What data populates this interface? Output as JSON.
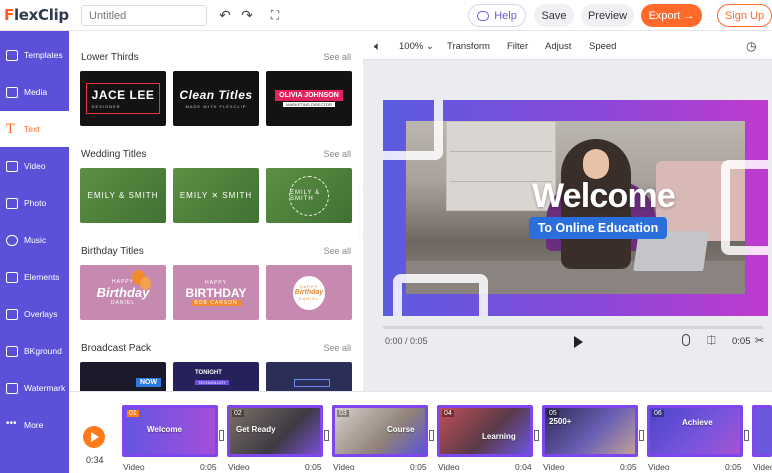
{
  "header": {
    "logo_prefix": "F",
    "logo_rest": "lexClip",
    "title_placeholder": "Untitled",
    "help_label": "Help",
    "save_label": "Save",
    "preview_label": "Preview",
    "export_label": "Export →",
    "signup_label": "Sign Up"
  },
  "sidebar": {
    "items": [
      {
        "label": "Templates"
      },
      {
        "label": "Media"
      },
      {
        "label": "Text",
        "active": true
      },
      {
        "label": "Video"
      },
      {
        "label": "Photo"
      },
      {
        "label": "Music"
      },
      {
        "label": "Elements"
      },
      {
        "label": "Overlays"
      },
      {
        "label": "BKground"
      },
      {
        "label": "Watermark"
      },
      {
        "label": "More"
      }
    ]
  },
  "panel": {
    "see_all": "See all",
    "sections": [
      {
        "title": "Lower Thirds",
        "thumbs": [
          {
            "main": "JACE LEE",
            "sub": "DESIGNER"
          },
          {
            "main": "Clean Titles",
            "sub": "MADE WITH FLEXCLIP"
          },
          {
            "main": "OLIVIA JOHNSON",
            "sub": "MARKETING DIRECTOR"
          }
        ]
      },
      {
        "title": "Wedding Titles",
        "thumbs": [
          {
            "main": "EMILY & SMITH"
          },
          {
            "main": "EMILY ✕ SMITH"
          },
          {
            "main": "EMILY & SMITH"
          }
        ]
      },
      {
        "title": "Birthday Titles",
        "thumbs": [
          {
            "main": "Birthday",
            "top": "HAPPY",
            "sub": "DANIEL"
          },
          {
            "main": "BIRTHDAY",
            "top": "HAPPY",
            "sub": "BOB CARSON"
          },
          {
            "main": "Birthday",
            "top": "HAPPY",
            "sub": "DANIEL"
          }
        ]
      },
      {
        "title": "Broadcast Pack",
        "thumbs": [
          {
            "main": "NOW"
          },
          {
            "main": "TONIGHT",
            "sub": "TECHNOLOGY"
          },
          {
            "main": ""
          }
        ]
      }
    ]
  },
  "editor": {
    "volume_icon": "speaker-icon",
    "zoom": "100%",
    "tools": [
      "Transform",
      "Filter",
      "Adjust",
      "Speed"
    ],
    "canvas_title": "Welcome",
    "canvas_subtitle": "To Online Education",
    "current_time": "0:00 / 0:05",
    "clip_duration": "0:05"
  },
  "timeline": {
    "total_time": "0:34",
    "clips": [
      {
        "num": "01",
        "text": "Welcome",
        "label": "Video",
        "duration": "0:05"
      },
      {
        "num": "02",
        "text": "Get Ready",
        "label": "Video",
        "duration": "0:05"
      },
      {
        "num": "03",
        "text": "Course",
        "label": "Video",
        "duration": "0:05"
      },
      {
        "num": "04",
        "text": "Learning",
        "label": "Video",
        "duration": "0:04"
      },
      {
        "num": "05",
        "text": "2500+",
        "label": "Video",
        "duration": "0:05"
      },
      {
        "num": "06",
        "text": "Achieve",
        "label": "Video",
        "duration": "0:05"
      },
      {
        "num": "",
        "text": "",
        "label": "Video",
        "duration": ""
      }
    ]
  },
  "colors": {
    "sidebar": "#5b51d8",
    "accent": "#ff6a2a",
    "clip_border": "#8046ee"
  }
}
